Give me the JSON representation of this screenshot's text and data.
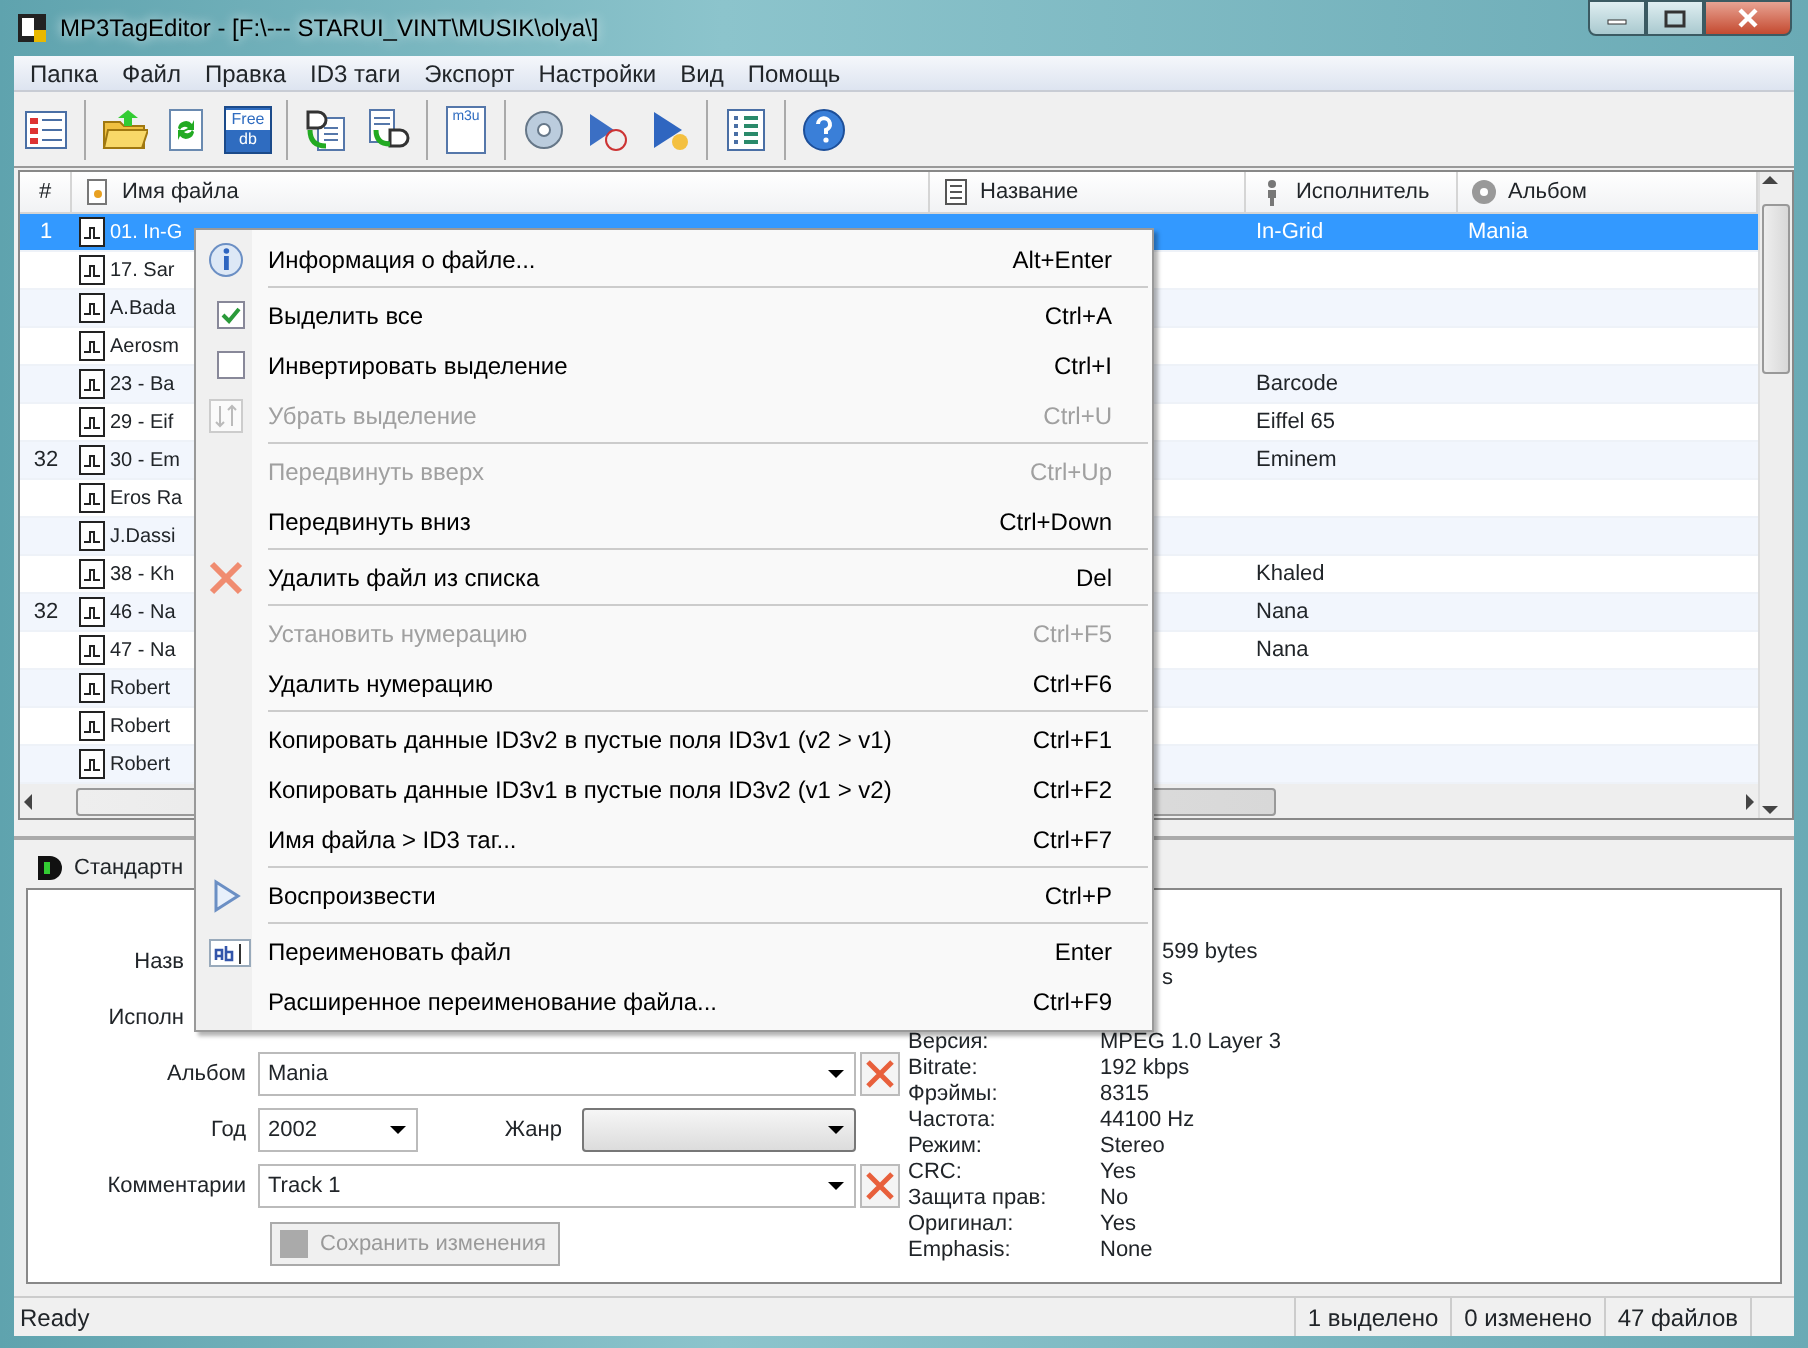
{
  "window": {
    "title": "MP3TagEditor - [F:\\---    STARUI_VINT\\MUSIK\\olya\\]"
  },
  "menu_bar": [
    "Папка",
    "Файл",
    "Правка",
    "ID3 таги",
    "Экспорт",
    "Настройки",
    "Вид",
    "Помощь"
  ],
  "toolbar": [
    {
      "kind": "list"
    },
    {
      "kind": "sep"
    },
    {
      "kind": "open"
    },
    {
      "kind": "refresh"
    },
    {
      "kind": "freedb",
      "lines": [
        "Free",
        "db"
      ]
    },
    {
      "kind": "sep"
    },
    {
      "kind": "doc-in"
    },
    {
      "kind": "doc-out"
    },
    {
      "kind": "sep"
    },
    {
      "kind": "playlist",
      "lines": [
        "m3u"
      ]
    },
    {
      "kind": "sep"
    },
    {
      "kind": "info"
    },
    {
      "kind": "play-cd"
    },
    {
      "kind": "play"
    },
    {
      "kind": "sep"
    },
    {
      "kind": "list2"
    },
    {
      "kind": "sep"
    },
    {
      "kind": "help"
    }
  ],
  "table": {
    "columns": [
      {
        "label": "#",
        "kind": "plain"
      },
      {
        "label": "Имя файла",
        "kind": "file"
      },
      {
        "label": "Название",
        "kind": "doc"
      },
      {
        "label": "Исполнитель",
        "kind": "person"
      },
      {
        "label": "Альбом",
        "kind": "disc"
      }
    ],
    "rows": [
      {
        "number": "1",
        "file": "01. In-G",
        "artist": "In-Grid",
        "album": "Mania",
        "selected": true
      },
      {
        "file": "17. Sar",
        "selected": false
      },
      {
        "file": "A.Bada",
        "selected": false
      },
      {
        "file": "Aerosm",
        "selected": false
      },
      {
        "file": "23 - Ba",
        "artist": "Barcode",
        "selected": false
      },
      {
        "file": "29 - Eif",
        "artist": "Eiffel 65",
        "selected": false
      },
      {
        "number": "32",
        "file": "30 - Em",
        "artist": "Eminem",
        "selected": false
      },
      {
        "file": "Eros Ra",
        "selected": false
      },
      {
        "file": "J.Dassi",
        "selected": false
      },
      {
        "file": "38 - Kh",
        "artist": "Khaled",
        "selected": false
      },
      {
        "number": "32",
        "file": "46 - Na",
        "artist": "Nana",
        "selected": false
      },
      {
        "file": "47 - Na",
        "artist": "Nana",
        "selected": false
      },
      {
        "file": "Robert",
        "selected": false
      },
      {
        "file": "Robert",
        "selected": false
      },
      {
        "file": "Robert",
        "selected": false
      }
    ]
  },
  "lower_panel": {
    "tab": "Стандартн",
    "form": [
      {
        "label": "Назв",
        "kind": "hidden"
      },
      {
        "label": "Исполн",
        "kind": "hidden"
      },
      {
        "label": "Альбом",
        "kind": "combo",
        "value": "Mania",
        "clear": true
      },
      {
        "label": "Год",
        "kind": "year",
        "value": "2002",
        "label2": "Жанр"
      },
      {
        "label": "Комментарии",
        "kind": "combo",
        "value": "Track 1",
        "clear": true
      }
    ],
    "save_button": {
      "label": "Сохранить изменения",
      "disabled": true
    },
    "info": [
      {
        "kind": "partial",
        "value": "599 bytes"
      },
      {
        "kind": "partial",
        "value": "s"
      },
      {
        "kind": "row",
        "label": "Версия:",
        "value": "MPEG 1.0 Layer 3"
      },
      {
        "kind": "row",
        "label": "Bitrate:",
        "value": "192 kbps"
      },
      {
        "kind": "row",
        "label": "Фрэймы:",
        "value": "8315"
      },
      {
        "kind": "row",
        "label": "Частота:",
        "value": "44100 Hz"
      },
      {
        "kind": "row",
        "label": "Режим:",
        "value": "Stereo"
      },
      {
        "kind": "row",
        "label": "CRC:",
        "value": "Yes"
      },
      {
        "kind": "row",
        "label": "Защита прав:",
        "value": "No"
      },
      {
        "kind": "row",
        "label": "Оригинал:",
        "value": "Yes"
      },
      {
        "kind": "row",
        "label": "Emphasis:",
        "value": "None"
      }
    ]
  },
  "context_menu": [
    {
      "kind": "info",
      "label": "Информация о файле...",
      "shortcut": "Alt+Enter",
      "disabled": false
    },
    {
      "kind": "separator"
    },
    {
      "kind": "check",
      "checked": true,
      "label": "Выделить все",
      "shortcut": "Ctrl+A",
      "disabled": false
    },
    {
      "kind": "check",
      "checked": false,
      "label": "Инвертировать выделение",
      "shortcut": "Ctrl+I",
      "disabled": false
    },
    {
      "kind": "unselect",
      "label": "Убрать выделение",
      "shortcut": "Ctrl+U",
      "disabled": true
    },
    {
      "kind": "separator"
    },
    {
      "kind": "item",
      "label": "Передвинуть вверх",
      "shortcut": "Ctrl+Up",
      "disabled": true
    },
    {
      "kind": "item",
      "label": "Передвинуть вниз",
      "shortcut": "Ctrl+Down",
      "disabled": false
    },
    {
      "kind": "separator"
    },
    {
      "kind": "delete",
      "label": "Удалить файл из списка",
      "shortcut": "Del",
      "disabled": false
    },
    {
      "kind": "separator"
    },
    {
      "kind": "item",
      "label": "Установить нумерацию",
      "shortcut": "Ctrl+F5",
      "disabled": true
    },
    {
      "kind": "item",
      "label": "Удалить нумерацию",
      "shortcut": "Ctrl+F6",
      "disabled": false
    },
    {
      "kind": "separator"
    },
    {
      "kind": "item",
      "label": "Копировать данные ID3v2 в пустые поля ID3v1 (v2 > v1)",
      "shortcut": "Ctrl+F1",
      "disabled": false
    },
    {
      "kind": "item",
      "label": "Копировать данные ID3v1 в пустые поля ID3v2 (v1 > v2)",
      "shortcut": "Ctrl+F2",
      "disabled": false
    },
    {
      "kind": "item",
      "label": "Имя файла > ID3 таг...",
      "shortcut": "Ctrl+F7",
      "disabled": false
    },
    {
      "kind": "separator"
    },
    {
      "kind": "play",
      "label": "Воспроизвести",
      "shortcut": "Ctrl+P",
      "disabled": false
    },
    {
      "kind": "separator"
    },
    {
      "kind": "rename",
      "label": "Переименовать файл",
      "shortcut": "Enter",
      "disabled": false
    },
    {
      "kind": "item",
      "label": "Расширенное переименование файла...",
      "shortcut": "Ctrl+F9",
      "disabled": false
    }
  ],
  "status_bar": {
    "message": "Ready",
    "panels": [
      "1 выделено",
      "0 изменено",
      "47 файлов"
    ]
  }
}
